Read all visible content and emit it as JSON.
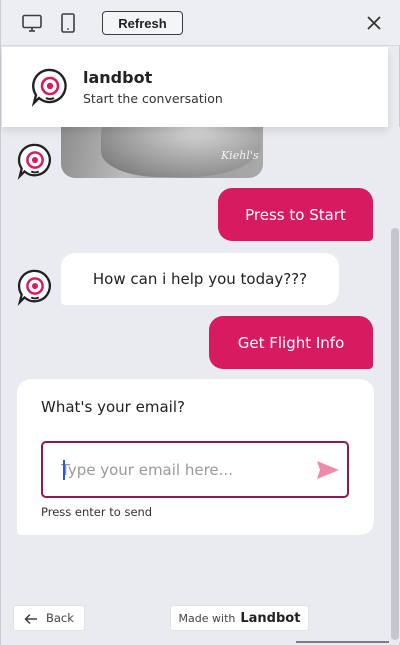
{
  "toolbar": {
    "desktop_icon": "desktop-monitor-icon",
    "mobile_icon": "mobile-phone-icon",
    "refresh_label": "Refresh",
    "close_icon": "close-x-icon"
  },
  "header": {
    "logo_icon": "landbot-logo-icon",
    "title": "landbot",
    "subtitle": "Start the conversation"
  },
  "chat": {
    "image_message": {
      "brand_text": "Kiehl's"
    },
    "messages": [
      {
        "from": "user",
        "text": "Press to Start"
      },
      {
        "from": "bot",
        "text": "How can i help you today???"
      },
      {
        "from": "user",
        "text": "Get Flight Info"
      }
    ],
    "email_prompt": {
      "question": "What's your email?",
      "placeholder": "Type your email here...",
      "value": "",
      "hint": "Press enter to send",
      "send_icon": "send-arrow-icon"
    }
  },
  "footer": {
    "back_label": "Back",
    "back_icon": "arrow-left-icon",
    "made_with_label": "Made with",
    "made_with_brand": "Landbot"
  },
  "colors": {
    "accent": "#d81b60",
    "input_border": "#8d1a54",
    "send_icon": "#f08aa8",
    "background": "#e9ebf0",
    "bubble_bot": "#ffffff"
  }
}
